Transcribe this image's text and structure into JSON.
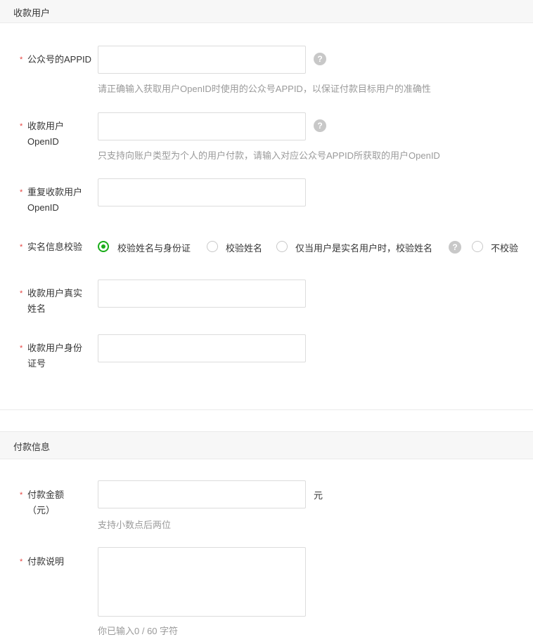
{
  "sections": {
    "payee": "收款用户",
    "payment": "付款信息"
  },
  "fields": {
    "appid": {
      "label": "公众号的APPID",
      "value": "",
      "hint": "请正确输入获取用户OpenID时使用的公众号APPID，以保证付款目标用户的准确性"
    },
    "openid": {
      "label": "收款用户OpenID",
      "value": "",
      "hint": "只支持向账户类型为个人的用户付款，请输入对应公众号APPID所获取的用户OpenID"
    },
    "repeat_openid": {
      "label": "重复收款用户OpenID",
      "value": ""
    },
    "realname_check": {
      "label": "实名信息校验",
      "options": [
        "校验姓名与身份证",
        "校验姓名",
        "仅当用户是实名用户时，校验姓名",
        "不校验"
      ],
      "selected": "校验姓名与身份证"
    },
    "real_name": {
      "label": "收款用户真实姓名",
      "value": ""
    },
    "id_number": {
      "label": "收款用户身份证号",
      "value": ""
    },
    "amount": {
      "label": "付款金额（元）",
      "value": "",
      "unit": "元",
      "hint": "支持小数点后两位"
    },
    "description": {
      "label": "付款说明",
      "value": "",
      "counter": "你已输入0 / 60 字符"
    }
  },
  "required_mark": "*",
  "help_icon": "?",
  "colors": {
    "accent": "#1aad19",
    "required": "#e64340",
    "hint": "#9a9a9a",
    "header_bg": "#f7f7f7"
  }
}
